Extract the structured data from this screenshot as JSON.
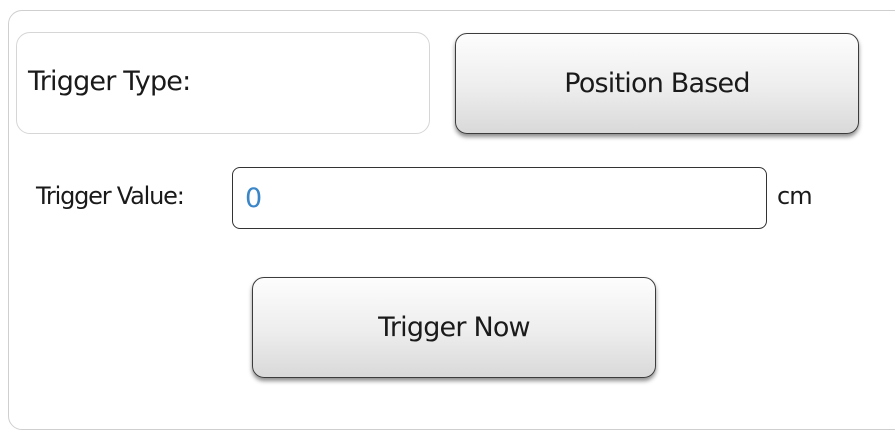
{
  "trigger_type": {
    "label": "Trigger Type:",
    "button_label": "Position Based"
  },
  "trigger_value": {
    "label": "Trigger Value:",
    "value": "0",
    "unit": "cm"
  },
  "trigger_now": {
    "button_label": "Trigger Now"
  },
  "colors": {
    "input_text": "#3a86c8",
    "button_border": "#3c3c3c",
    "panel_border": "#cfcfcf"
  }
}
